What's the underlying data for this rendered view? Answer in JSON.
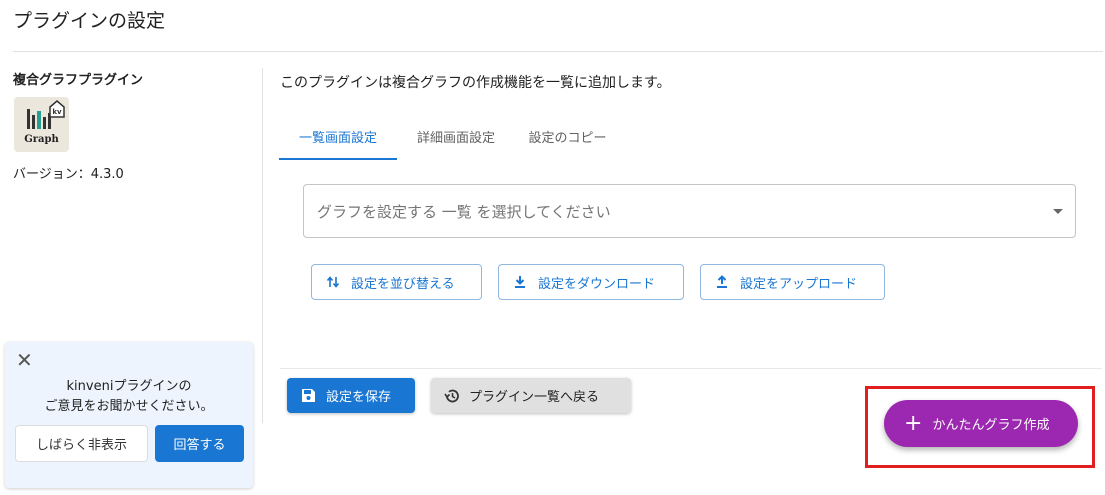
{
  "page": {
    "title": "プラグインの設定"
  },
  "sidebar": {
    "plugin_name": "複合グラフプラグイン",
    "logo": {
      "icon": "bar-chart-kv-icon",
      "word": "Graph",
      "badge": "kv"
    },
    "version": "バージョン：4.3.0"
  },
  "main": {
    "description": "このプラグインは複合グラフの作成機能を一覧に追加します。",
    "tabs": [
      {
        "label": "一覧画面設定",
        "active": true
      },
      {
        "label": "詳細画面設定",
        "active": false
      },
      {
        "label": "設定のコピー",
        "active": false
      }
    ],
    "select": {
      "placeholder": "グラフを設定する 一覧 を選択してください"
    },
    "actions": {
      "sort": "設定を並び替える",
      "download": "設定をダウンロード",
      "upload": "設定をアップロード"
    },
    "save": "設定を保存",
    "back": "プラグイン一覧へ戻る",
    "easy_graph": "かんたんグラフ作成"
  },
  "feedback": {
    "line1": "kinveniプラグインの",
    "line2": "ご意見をお聞かせください。",
    "later": "しばらく非表示",
    "answer": "回答する"
  },
  "colors": {
    "primary": "#1976d2",
    "accent": "#9c27b0",
    "highlight": "#e01e1e"
  }
}
